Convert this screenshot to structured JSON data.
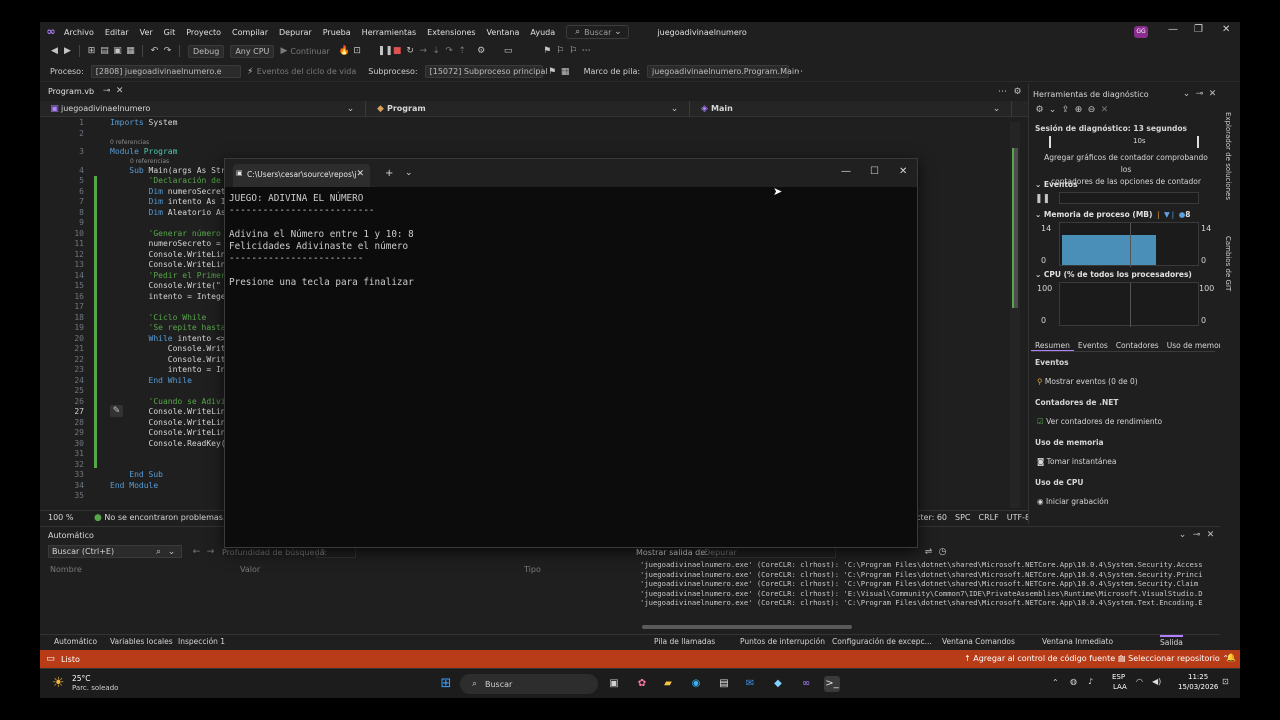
{
  "titlebar": {
    "menu": [
      "Archivo",
      "Editar",
      "Ver",
      "Git",
      "Proyecto",
      "Compilar",
      "Depurar",
      "Prueba",
      "Herramientas",
      "Extensiones",
      "Ventana",
      "Ayuda"
    ],
    "search_label": "Buscar",
    "solution_name": "juegoadivinaelnumero",
    "avatar_initials": "GG"
  },
  "toolbar": {
    "config": "Debug",
    "platform": "Any CPU",
    "continue_label": "Continuar"
  },
  "procbar": {
    "process_label": "Proceso:",
    "process_value": "[2808] juegoadivinaelnumero.e",
    "events_label": "Eventos del ciclo de vida",
    "thread_label": "Subproceso:",
    "thread_value": "[15072] Subproceso principal",
    "stack_label": "Marco de pila:",
    "stack_value": "juegoadivinaelnumero.Program.Main"
  },
  "editor": {
    "tab_name": "Program.vb",
    "nav_project": "juegoadivinaelnumero",
    "nav_class": "Program",
    "nav_method": "Main",
    "lines": [
      {
        "n": "1",
        "segments": [
          {
            "t": "Imports ",
            "c": "kw"
          },
          {
            "t": "System",
            "c": "tx"
          }
        ]
      },
      {
        "n": "2",
        "segments": []
      },
      {
        "n": "3",
        "ref": "0 referencias",
        "segments": [
          {
            "t": "Module ",
            "c": "kw"
          },
          {
            "t": "Program",
            "c": "ty"
          }
        ]
      },
      {
        "n": "4",
        "ref": "0 referencias",
        "segments": [
          {
            "t": "    Sub ",
            "c": "kw"
          },
          {
            "t": "Main(args As Str",
            "c": "tx"
          }
        ]
      },
      {
        "n": "5",
        "segments": [
          {
            "t": "        'Declaración de",
            "c": "cm"
          }
        ]
      },
      {
        "n": "6",
        "segments": [
          {
            "t": "        Dim ",
            "c": "kw"
          },
          {
            "t": "numeroSecret",
            "c": "tx"
          }
        ]
      },
      {
        "n": "7",
        "segments": [
          {
            "t": "        Dim ",
            "c": "kw"
          },
          {
            "t": "intento As I",
            "c": "tx"
          }
        ]
      },
      {
        "n": "8",
        "segments": [
          {
            "t": "        Dim ",
            "c": "kw"
          },
          {
            "t": "Aleatorio As",
            "c": "tx"
          }
        ]
      },
      {
        "n": "9",
        "segments": []
      },
      {
        "n": "10",
        "segments": [
          {
            "t": "        'Generar número",
            "c": "cm"
          }
        ]
      },
      {
        "n": "11",
        "segments": [
          {
            "t": "        numeroSecreto =",
            "c": "tx"
          }
        ]
      },
      {
        "n": "12",
        "segments": [
          {
            "t": "        Console.WriteLin",
            "c": "tx"
          }
        ]
      },
      {
        "n": "13",
        "segments": [
          {
            "t": "        Console.WriteLin",
            "c": "tx"
          }
        ]
      },
      {
        "n": "14",
        "segments": [
          {
            "t": "        'Pedir el Primer",
            "c": "cm"
          }
        ]
      },
      {
        "n": "15",
        "segments": [
          {
            "t": "        Console.Write(\"",
            "c": "tx"
          }
        ]
      },
      {
        "n": "16",
        "segments": [
          {
            "t": "        intento = Intege",
            "c": "tx"
          }
        ]
      },
      {
        "n": "17",
        "segments": []
      },
      {
        "n": "18",
        "segments": [
          {
            "t": "        'Ciclo While",
            "c": "cm"
          }
        ]
      },
      {
        "n": "19",
        "segments": [
          {
            "t": "        'Se repite hasta",
            "c": "cm"
          }
        ]
      },
      {
        "n": "20",
        "segments": [
          {
            "t": "        While ",
            "c": "kw"
          },
          {
            "t": "intento <>",
            "c": "tx"
          }
        ]
      },
      {
        "n": "21",
        "segments": [
          {
            "t": "            Console.Writ",
            "c": "tx"
          }
        ]
      },
      {
        "n": "22",
        "segments": [
          {
            "t": "            Console.Writ",
            "c": "tx"
          }
        ]
      },
      {
        "n": "23",
        "segments": [
          {
            "t": "            intento = In",
            "c": "tx"
          }
        ]
      },
      {
        "n": "24",
        "segments": [
          {
            "t": "        End While",
            "c": "kw"
          }
        ]
      },
      {
        "n": "25",
        "segments": []
      },
      {
        "n": "26",
        "segments": [
          {
            "t": "        'Cuando se Adivi",
            "c": "cm"
          }
        ]
      },
      {
        "n": "27",
        "segments": [
          {
            "t": "        Console.WriteLin",
            "c": "tx"
          }
        ]
      },
      {
        "n": "28",
        "segments": [
          {
            "t": "        Console.WriteLin",
            "c": "tx"
          }
        ]
      },
      {
        "n": "29",
        "segments": [
          {
            "t": "        Console.WriteLin",
            "c": "tx"
          }
        ]
      },
      {
        "n": "30",
        "segments": [
          {
            "t": "        Console.ReadKey(",
            "c": "tx"
          }
        ]
      },
      {
        "n": "31",
        "segments": []
      },
      {
        "n": "32",
        "segments": []
      },
      {
        "n": "33",
        "segments": [
          {
            "t": "    End Sub",
            "c": "kw"
          }
        ]
      },
      {
        "n": "34",
        "segments": [
          {
            "t": "End Module",
            "c": "kw"
          }
        ]
      },
      {
        "n": "35",
        "segments": []
      }
    ],
    "zoom": "100 %",
    "issues": "No se encontraron problemas.",
    "status_right": [
      "cter: 60",
      "SPC",
      "CRLF",
      "UTF-8"
    ]
  },
  "terminal": {
    "tab_title": "C:\\Users\\cesar\\source\\repos\\j",
    "lines": [
      "JUEGO: ADIVINA EL NÚMERO",
      "--------------------------",
      "",
      "Adivina el Número entre 1 y 10: 8",
      "Felicidades Adivinaste el número",
      "------------------------",
      "",
      "Presione una tecla para finalizar"
    ]
  },
  "diagnostics": {
    "title": "Herramientas de diagnóstico",
    "session": "Sesión de diagnóstico: 13 segundos",
    "timeline_tick": "10s",
    "hint": [
      "Agregar gráficos de contador comprobando los",
      "contadores de las opciones de contador"
    ],
    "events_section": "Eventos",
    "memory_section": "Memoria de proceso (MB)",
    "memory_legend_count": "8",
    "memory_max": "14",
    "memory_min": "0",
    "memory_level": 0.72,
    "cpu_section": "CPU (% de todos los procesadores)",
    "cpu_max": "100",
    "cpu_min": "0",
    "tabs": [
      "Resumen",
      "Eventos",
      "Contadores",
      "Uso de memori"
    ],
    "events_title": "Eventos",
    "show_events": "Mostrar eventos (0 de 0)",
    "net_counters": "Contadores de .NET",
    "perf_counters": "Ver contadores de rendimiento",
    "memory_usage": "Uso de memoria",
    "snapshot": "Tomar instantánea",
    "cpu_usage": "Uso de CPU",
    "start_recording": "Iniciar grabación"
  },
  "side_tabs": [
    "Explorador de soluciones",
    "Cambios de GIT"
  ],
  "autos": {
    "title": "Automático",
    "search_placeholder": "Buscar (Ctrl+E)",
    "depth_label": "Profundidad de búsqueda:",
    "depth_value": "3",
    "columns": [
      "Nombre",
      "Valor",
      "Tipo"
    ]
  },
  "output": {
    "show_label": "Mostrar salida de:",
    "source": "Depurar",
    "lines": [
      "'juegoadivinaelnumero.exe' (CoreCLR: clrhost): 'C:\\Program Files\\dotnet\\shared\\Microsoft.NETCore.App\\10.0.4\\System.Security.Access",
      "'juegoadivinaelnumero.exe' (CoreCLR: clrhost): 'C:\\Program Files\\dotnet\\shared\\Microsoft.NETCore.App\\10.0.4\\System.Security.Princi",
      "'juegoadivinaelnumero.exe' (CoreCLR: clrhost): 'C:\\Program Files\\dotnet\\shared\\Microsoft.NETCore.App\\10.0.4\\System.Security.Claim",
      "'juegoadivinaelnumero.exe' (CoreCLR: clrhost): 'E:\\Visual\\Community\\Common7\\IDE\\PrivateAssemblies\\Runtime\\Microsoft.VisualStudio.D",
      "'juegoadivinaelnumero.exe' (CoreCLR: clrhost): 'C:\\Program Files\\dotnet\\shared\\Microsoft.NETCore.App\\10.0.4\\System.Text.Encoding.E"
    ]
  },
  "bottom_tabs_left": [
    "Automático",
    "Variables locales",
    "Inspección 1"
  ],
  "bottom_tabs_right": [
    "Pila de llamadas",
    "Puntos de interrupción",
    "Configuración de excepc...",
    "Ventana Comandos",
    "Ventana Inmediato",
    "Salida"
  ],
  "vsstatus": {
    "ready": "Listo",
    "source_control": "Agregar al control de código fuente",
    "repo": "Seleccionar repositorio"
  },
  "taskbar": {
    "temp": "25°C",
    "weather": "Parc. soleado",
    "search": "Buscar",
    "lang": "ESP",
    "lang2": "LAA",
    "time": "11:25",
    "date": "15/03/2026"
  },
  "colors": {
    "accent": "#b180ff",
    "status_bar": "#b83c17",
    "memory_fill": "#4a8fb8"
  }
}
